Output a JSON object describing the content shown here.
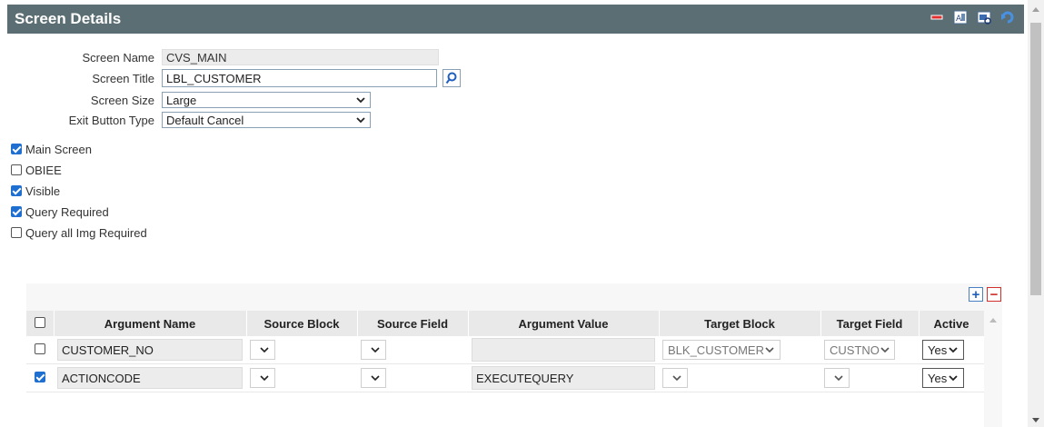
{
  "window": {
    "title": "Screen Details"
  },
  "form": {
    "screen_name": {
      "label": "Screen Name",
      "value": "CVS_MAIN"
    },
    "screen_title": {
      "label": "Screen Title",
      "value": "LBL_CUSTOMER"
    },
    "screen_size": {
      "label": "Screen Size",
      "value": "Large"
    },
    "exit_button_type": {
      "label": "Exit Button Type",
      "value": "Default Cancel"
    }
  },
  "checkboxes": [
    {
      "label": "Main Screen",
      "checked": true
    },
    {
      "label": "OBIEE",
      "checked": false
    },
    {
      "label": "Visible",
      "checked": true
    },
    {
      "label": "Query Required",
      "checked": true
    },
    {
      "label": "Query all Img Required",
      "checked": false
    }
  ],
  "grid": {
    "columns": [
      "Argument Name",
      "Source Block",
      "Source Field",
      "Argument Value",
      "Target Block",
      "Target Field",
      "Active"
    ],
    "rows": [
      {
        "checked": false,
        "argument_name": "CUSTOMER_NO",
        "source_block": "",
        "source_field": "",
        "argument_value": "",
        "target_block": "BLK_CUSTOMER",
        "target_field": "CUSTNO",
        "active": "Yes"
      },
      {
        "checked": true,
        "argument_name": "ACTIONCODE",
        "source_block": "",
        "source_field": "",
        "argument_value": "EXECUTEQUERY",
        "target_block": "",
        "target_field": "",
        "active": "Yes"
      }
    ],
    "add_label": "+",
    "remove_label": "−"
  },
  "colors": {
    "titlebar": "#5a6e73",
    "checkbox": "#1e6fd0",
    "accent_blue": "#1f5fbf",
    "accent_red": "#d0312d"
  }
}
